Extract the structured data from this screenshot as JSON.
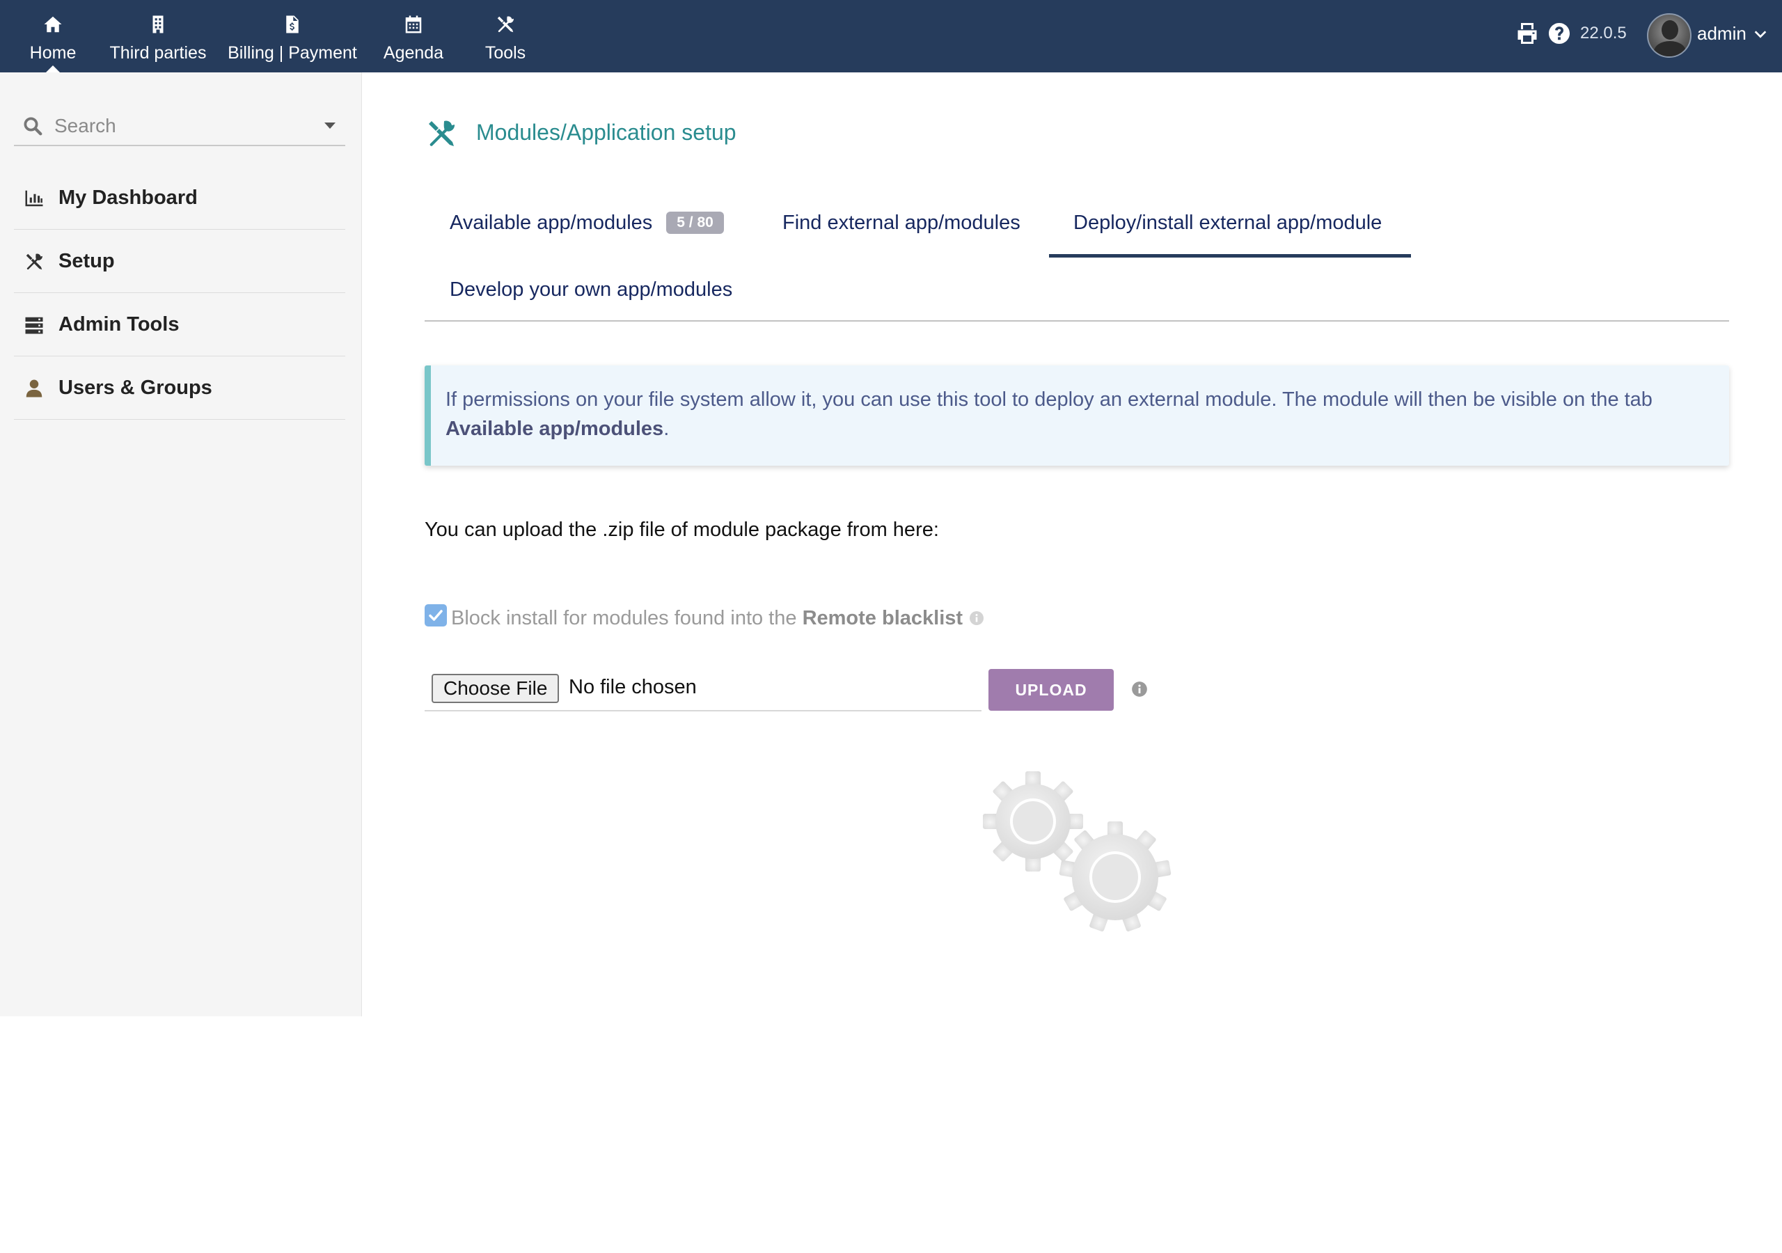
{
  "topbar": {
    "nav": [
      {
        "label": "Home",
        "icon": "home-icon"
      },
      {
        "label": "Third parties",
        "icon": "building-icon"
      },
      {
        "label": "Billing | Payment",
        "icon": "invoice-icon"
      },
      {
        "label": "Agenda",
        "icon": "calendar-icon"
      },
      {
        "label": "Tools",
        "icon": "tools-icon"
      }
    ],
    "active_nav": "Home",
    "version": "22.0.5",
    "username": "admin",
    "icons": [
      "print-icon",
      "help-icon",
      "avatar",
      "chevron-down-icon"
    ],
    "background_color": "#263c5c"
  },
  "sidebar": {
    "search_placeholder": "Search",
    "items": [
      {
        "label": "My Dashboard",
        "icon": "bar-chart-icon"
      },
      {
        "label": "Setup",
        "icon": "tools-icon"
      },
      {
        "label": "Admin Tools",
        "icon": "server-icon"
      },
      {
        "label": "Users & Groups",
        "icon": "user-icon"
      }
    ]
  },
  "main": {
    "page_title": "Modules/Application setup",
    "tabs": [
      {
        "label": "Available app/modules",
        "badge": "5 / 80"
      },
      {
        "label": "Find external app/modules"
      },
      {
        "label": "Deploy/install external app/module",
        "active": true
      },
      {
        "label": "Develop your own app/modules"
      }
    ],
    "info": {
      "text": "If permissions on your file system allow it, you can use this tool to deploy an external module. The module will then be visible on the tab",
      "link_text": "Available app/modules",
      "suffix": "."
    },
    "upload_text": "You can upload the .zip file of module package from here:",
    "blacklist": {
      "checked": true,
      "label_prefix": "Block install for modules found into the",
      "label_bold": "Remote blacklist"
    },
    "file": {
      "choose_label": "Choose File",
      "status": "No file chosen"
    },
    "upload_button": "UPLOAD",
    "colors": {
      "title": "#2a8c8f",
      "upload_button": "#a07cad",
      "info_border": "#79c6c9",
      "info_background": "#eef6fc"
    }
  }
}
